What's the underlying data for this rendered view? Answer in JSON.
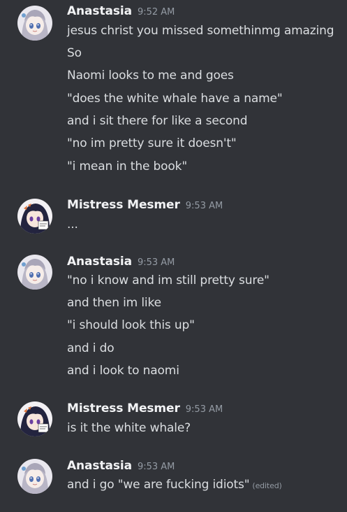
{
  "messages": [
    {
      "author": "Anastasia",
      "time": "9:52 AM",
      "lines": [
        "jesus christ you missed somethinmg amazing",
        "So",
        "Naomi looks to me and goes",
        "\"does the white whale have a name\"",
        "and i sit there for like a second",
        "\"no im pretty sure it doesn't\"",
        "\"i mean in the book\""
      ]
    },
    {
      "author": "Mistress Mesmer",
      "time": "9:53 AM",
      "lines": [
        "..."
      ]
    },
    {
      "author": "Anastasia",
      "time": "9:53 AM",
      "lines": [
        "\"no i know and im still pretty sure\"",
        "and then im like",
        "\"i should look this up\"",
        "and i do",
        "and i look to naomi"
      ]
    },
    {
      "author": "Mistress Mesmer",
      "time": "9:53 AM",
      "lines": [
        "is it the white whale?"
      ]
    },
    {
      "author": "Anastasia",
      "time": "9:53 AM",
      "lines": [
        "and i go \"we are fucking idiots\""
      ],
      "edited_label": "(edited)"
    }
  ],
  "colors": {
    "background": "#313338",
    "username": "#f2f3f5",
    "text": "#dbdee1",
    "muted": "#949ba4"
  }
}
